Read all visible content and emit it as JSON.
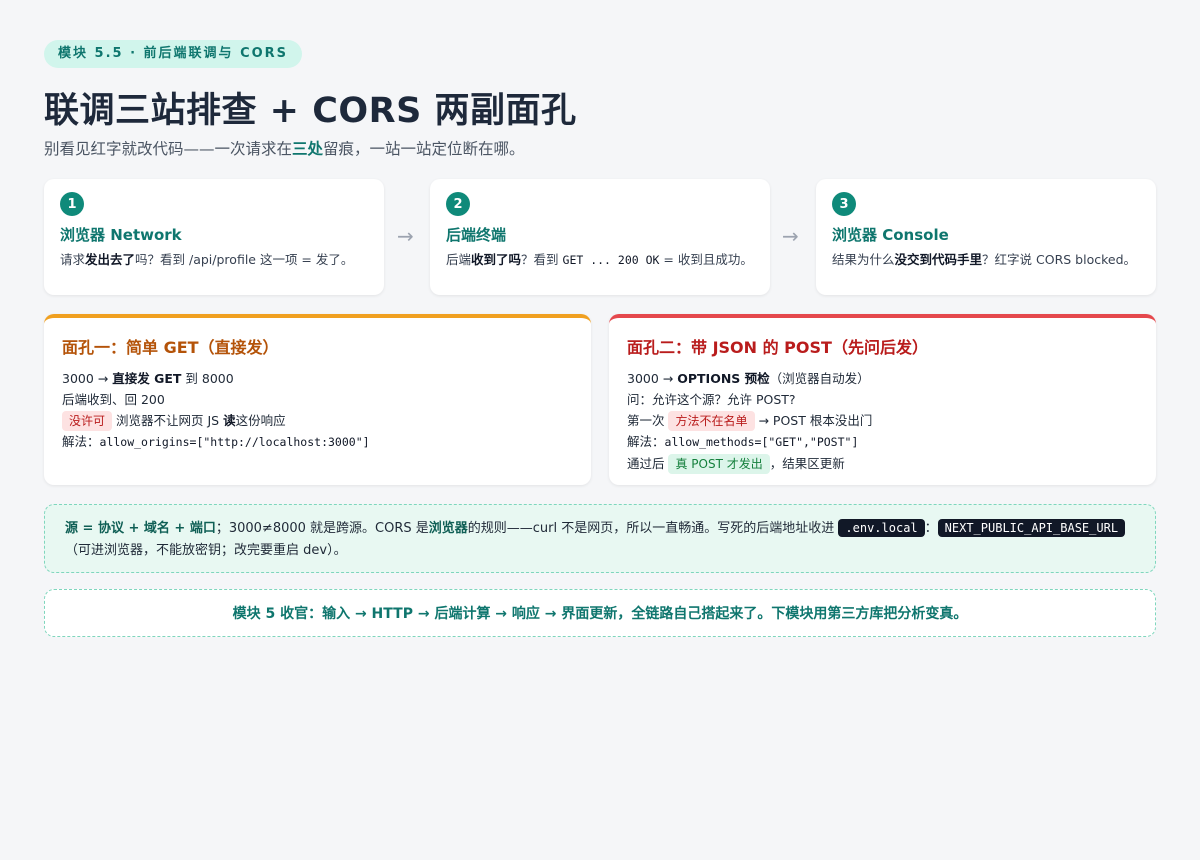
{
  "tag": "模块 5.5 · 前后端联调与 CORS",
  "title": "联调三站排查 + CORS 两副面孔",
  "subtitle": {
    "pre": "别看见红字就改代码——一次请求在",
    "bold": "三处",
    "post": "留痕，一站一站定位断在哪。"
  },
  "steps": [
    {
      "num": "1",
      "title": "浏览器 Network",
      "parts": [
        {
          "t": "请求"
        },
        {
          "t": "发出去了",
          "b": true
        },
        {
          "t": "吗？看到 /api/profile 这一项 = 发了。"
        }
      ]
    },
    {
      "num": "2",
      "title": "后端终端",
      "parts": [
        {
          "t": "后端"
        },
        {
          "t": "收到了吗",
          "b": true
        },
        {
          "t": "？看到 "
        },
        {
          "t": "GET ... 200 OK",
          "m": true
        },
        {
          "t": " = 收到且成功。"
        }
      ]
    },
    {
      "num": "3",
      "title": "浏览器 Console",
      "parts": [
        {
          "t": "结果为什么"
        },
        {
          "t": "没交到代码手里",
          "b": true
        },
        {
          "t": "？红字说 CORS blocked。"
        }
      ]
    }
  ],
  "arrows": [
    "→",
    "→"
  ],
  "faces": [
    {
      "title": "面孔一：简单 GET（直接发）",
      "lines": [
        [
          {
            "t": "3000 → "
          },
          {
            "t": "直接发 GET",
            "b": true
          },
          {
            "t": " 到 8000"
          }
        ],
        [
          {
            "t": "后端收到、回 200"
          }
        ],
        [
          {
            "t": "没许可",
            "p": "red"
          },
          {
            "t": " 浏览器不让网页 JS "
          },
          {
            "t": "读",
            "b": true
          },
          {
            "t": "这份响应"
          }
        ],
        [
          {
            "t": "解法："
          },
          {
            "t": "allow_origins=[\"http://localhost:3000\"]",
            "m": true
          }
        ]
      ]
    },
    {
      "title": "面孔二：带 JSON 的 POST（先问后发）",
      "lines": [
        [
          {
            "t": "3000 → "
          },
          {
            "t": "OPTIONS 预检",
            "b": true
          },
          {
            "t": "（浏览器自动发）"
          }
        ],
        [
          {
            "t": "问：允许这个源？允许 POST?"
          }
        ],
        [
          {
            "t": "第一次 "
          },
          {
            "t": "方法不在名单",
            "p": "red"
          },
          {
            "t": " → POST 根本没出门"
          }
        ],
        [
          {
            "t": "解法："
          },
          {
            "t": "allow_methods=[\"GET\",\"POST\"]",
            "m": true
          }
        ],
        [
          {
            "t": "通过后 "
          },
          {
            "t": "真 POST 才发出",
            "p": "green"
          },
          {
            "t": "，结果区更新"
          }
        ]
      ]
    }
  ],
  "note": [
    {
      "t": "源 = 协议 + 域名 + 端口",
      "b": true
    },
    {
      "t": "；3000≠8000 就是跨源。CORS 是"
    },
    {
      "t": "浏览器",
      "b": true
    },
    {
      "t": "的规则——curl 不是网页，所以一直畅通。写死的后端地址收进 "
    },
    {
      "t": ".env.local",
      "c": true
    },
    {
      "t": "："
    },
    {
      "t": "NEXT_PUBLIC_API_BASE_URL",
      "c": true
    },
    {
      "t": "（可进浏览器，不能放密钥；改完要重启 dev）。"
    }
  ],
  "summary": "模块 5 收官：输入 → HTTP → 后端计算 → 响应 → 界面更新，全链路自己搭起来了。下模块用第三方库把分析变真。"
}
